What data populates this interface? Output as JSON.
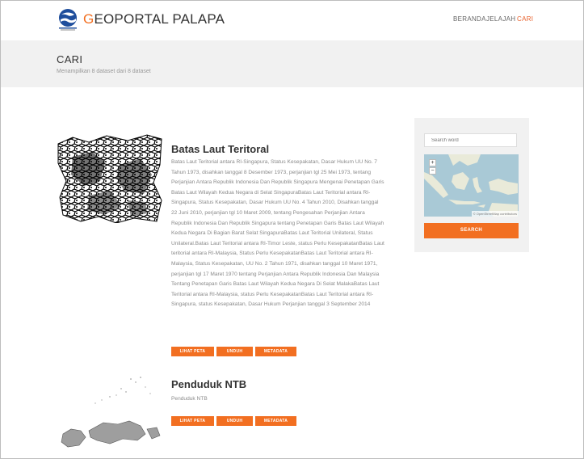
{
  "brand": {
    "initial": "G",
    "rest": "EOPORTAL PALAPA"
  },
  "nav": [
    {
      "label": "BERANDA"
    },
    {
      "label": "JELAJAH"
    },
    {
      "label": "CARI"
    }
  ],
  "page": {
    "title": "CARI",
    "subtitle": "Menampilkan 8 dataset dari 8 dataset"
  },
  "datasets": [
    {
      "title": "Batas Laut Teritoral",
      "description": "Batas Laut Teritorial antara RI-Singapura, Status Kesepakatan, Dasar Hukum UU No. 7 Tahun 1973, disahkan tanggal 8 Desember 1973, perjanjian tgl 25 Mei 1973, tentang Perjanjian Antara Republik Indonesia Dan Republik Singapura Mengenai Penetapan Garis Batas Laut Wilayah Kedua Negara di Selat SingapuraBatas Laut Teritorial antara RI-Singapura, Status Kesepakatan, Dasar Hukum UU No. 4 Tahun 2010, Disahkan tanggal 22 Juni 2010, perjanjian tgl 10 Maret 2009, tentang Pengesahan Perjanjian Antara Republik Indonesia Dan Republik Singapura tentang Penetapan Garis Batas Laut Wilayah Kedua Negara Di Bagian Barat Selat SingapuraBatas Laut Teritorial Unilateral, Status Unilateral.Batas Laut Teritorial antara RI-Timor Leste, status Perlu KesepakatanBatas Laut teritorial antara RI-Malaysia, Status Perlu KesepakatanBatas Laut Teritorial antara RI-Malaysia, Status Kesepakatan, UU No. 2 Tahun 1971, disahkan tanggal 10 Maret 1971, perjanjian tgl 17 Maret 1970 tentang Perjanjian Antara Republik Indonesia Dan Malaysia Tentang Penetapan Garis Batas Laut Wilayah Kedua Negara Di Selat MalakaBatas Laut Teritorial antara RI-Malaysia, status Perlu KesepakatanBatas Laut Teritorial antara RI-Singapura, status Kesepakatan, Dasar Hukum Perjanjian tanggal 3 September 2014",
      "buttons": [
        "LIHAT PETA",
        "UNDUH",
        "METADATA"
      ]
    },
    {
      "title": "Penduduk NTB",
      "description": "Penduduk NTB",
      "buttons": [
        "LIHAT PETA",
        "UNDUH",
        "METADATA"
      ]
    }
  ],
  "sidebar": {
    "search_placeholder": "Search word",
    "zoom_in": "+",
    "zoom_out": "−",
    "map_attribution": "© OpenStreetMap contributors",
    "search_button": "SEARCH"
  },
  "colors": {
    "accent": "#f26f21",
    "band": "#f1f1f1",
    "sea": "#a9c9d6",
    "land": "#e9ead9"
  }
}
